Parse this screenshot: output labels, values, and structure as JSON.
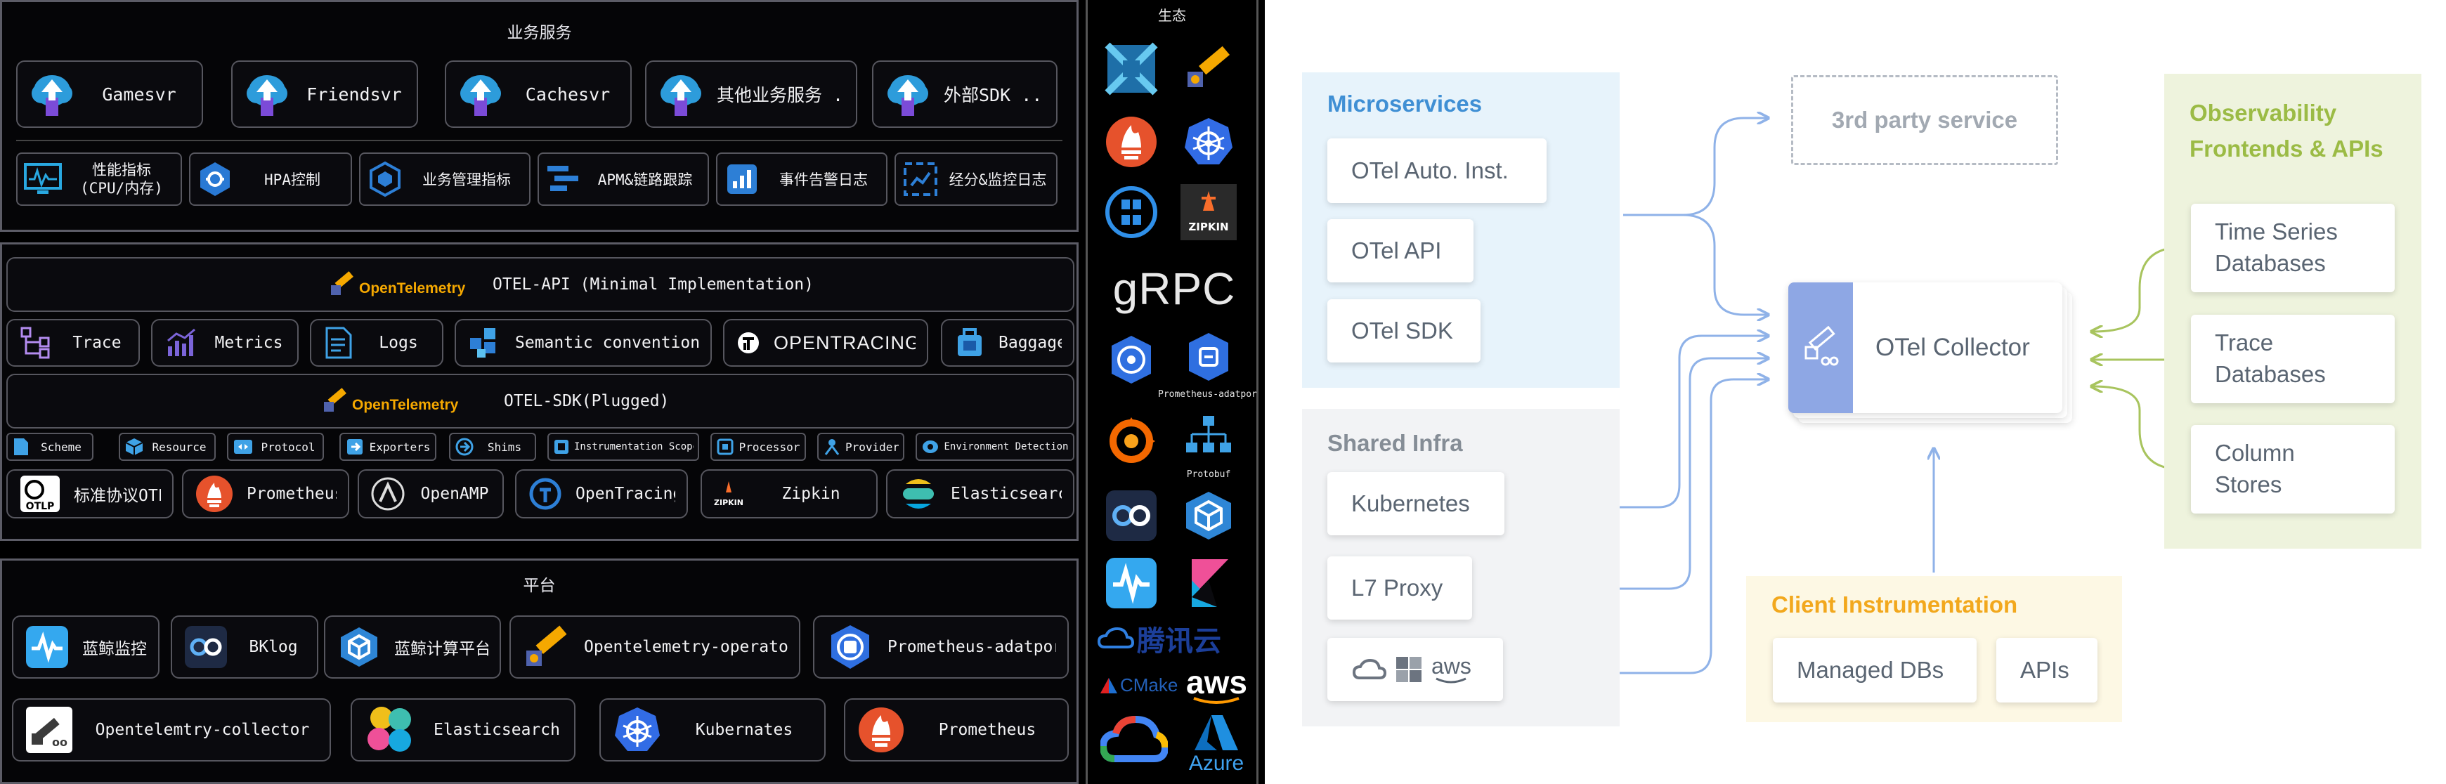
{
  "left": {
    "business": {
      "title": "业务服务",
      "services": [
        "Gamesvr",
        "Friendsvr",
        "Cachesvr",
        "其他业务服务 ...",
        "外部SDK ..."
      ],
      "tools": [
        "性能指标\n(CPU/内存)",
        "HPA控制",
        "业务管理指标",
        "APM&链路跟踪",
        "事件告警日志",
        "经分&监控日志"
      ]
    },
    "otel": {
      "api_title": "OTEL-API (Minimal Implementation)",
      "sdk_title": "OTEL-SDK(Plugged)",
      "logo": "OpenTelemetry",
      "api_items": [
        "Trace",
        "Metrics",
        "Logs",
        "Semantic conventions",
        "OPENTRACING",
        "Baggage"
      ],
      "sdk_items": [
        "Scheme",
        "Resource",
        "Protocol",
        "Exporters",
        "Shims",
        "Instrumentation Scope",
        "Processor",
        "Provider",
        "Environment Detection"
      ],
      "exporters": [
        "标准协议OTLP",
        "Prometheus",
        "OpenAMP",
        "OpenTracing",
        "Zipkin",
        "Elasticsearch"
      ]
    },
    "platform": {
      "title": "平台",
      "row1": [
        "蓝鲸监控",
        "BKlog",
        "蓝鲸计算平台",
        "Opentelemetry-operator",
        "Prometheus-adatpor"
      ],
      "row2": [
        "Opentelemtry-collector",
        "Elasticsearch",
        "Kubernates",
        "Prometheus"
      ]
    },
    "ecosystem": {
      "title": "生态",
      "grpc": "gRPC",
      "zipkin": "ZIPKIN",
      "prom_adaptor": "Prometheus-adatpor",
      "protobuf": "Protobuf",
      "tencent": "腾讯云",
      "cmake": "CMake",
      "aws": "aws",
      "azure": "Azure"
    }
  },
  "right": {
    "microservices": {
      "title": "Microservices",
      "items": [
        "OTel Auto. Inst.",
        "OTel API",
        "OTel SDK"
      ]
    },
    "shared_infra": {
      "title": "Shared Infra",
      "items": [
        "Kubernetes",
        "L7 Proxy"
      ],
      "cloud_aws": "aws"
    },
    "third_party": "3rd party service",
    "collector": "OTel Collector",
    "client": {
      "title": "Client Instrumentation",
      "items": [
        "Managed DBs",
        "APIs"
      ]
    },
    "observability": {
      "title": "Observability\nFrontends & APIs",
      "items": [
        "Time Series\nDatabases",
        "Trace\nDatabases",
        "Column\nStores"
      ]
    },
    "colors": {
      "blue": "#3f8fd4",
      "blue_bg": "#e7f3fb",
      "gray_bg": "#f2f3f5",
      "orange": "#f2a81d",
      "orange_bg": "#fdf8e4",
      "green": "#9bbb45",
      "green_bg": "#eef3dd",
      "arrow_blue": "#8fb2e8",
      "arrow_green": "#a8c45e",
      "collector_blue": "#8ea7e4"
    }
  }
}
